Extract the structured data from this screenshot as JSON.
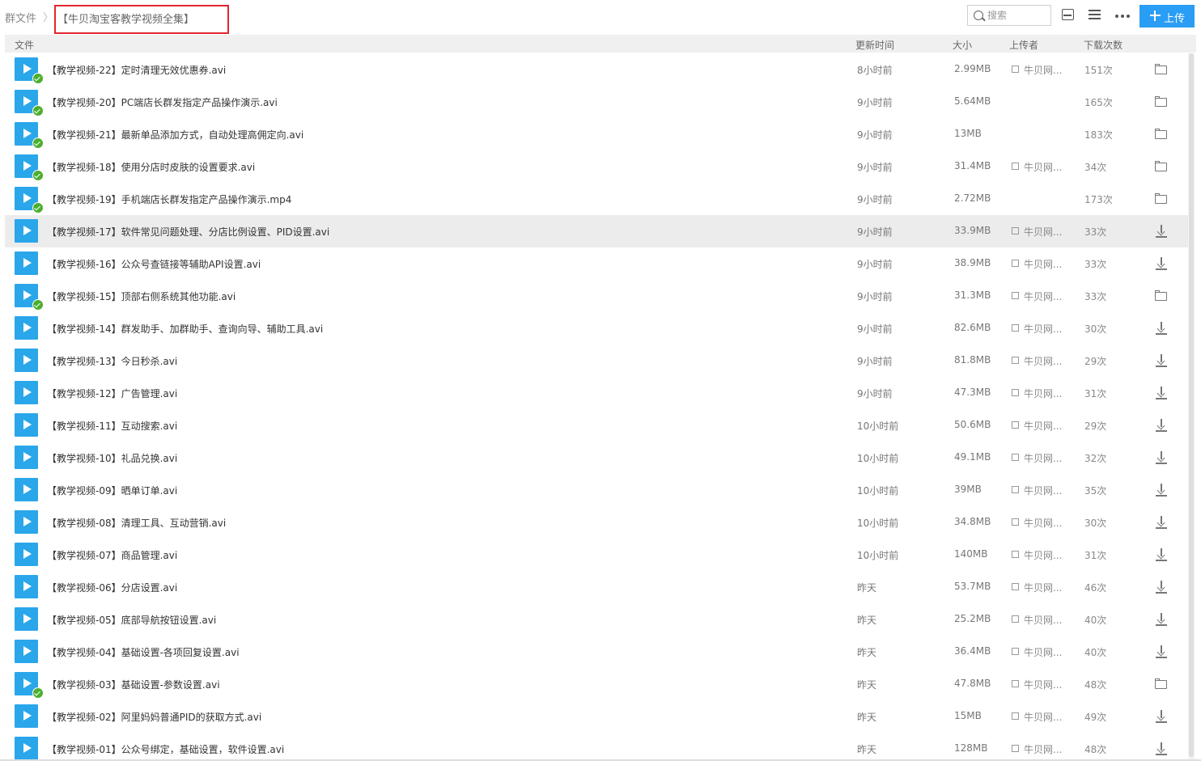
{
  "breadcrumb": {
    "root": "群文件",
    "separator": "〉",
    "current": "【牛贝淘宝客教学视频全集】"
  },
  "toolbar": {
    "search_placeholder": "搜索",
    "upload_label": "上传"
  },
  "columns": {
    "file": "文件",
    "updated": "更新时间",
    "size": "大小",
    "uploader": "上传者",
    "downloads": "下载次数"
  },
  "colors": {
    "accent": "#2a9df4",
    "play_icon": "#2aa6ea",
    "check": "#4caf2e",
    "highlight_border": "#e2262f"
  },
  "files": [
    {
      "name": "【教学视频-22】定时清理无效优惠券.avi",
      "time": "8小时前",
      "size": "2.99MB",
      "uploader": "牛贝网...",
      "downloads": "151次",
      "downloaded": true,
      "action": "folder-icon"
    },
    {
      "name": "【教学视频-20】PC端店长群发指定产品操作演示.avi",
      "time": "9小时前",
      "size": "5.64MB",
      "uploader": "",
      "downloads": "165次",
      "downloaded": true,
      "action": "folder-icon"
    },
    {
      "name": "【教学视频-21】最新单品添加方式，自动处理高佣定向.avi",
      "time": "9小时前",
      "size": "13MB",
      "uploader": "",
      "downloads": "183次",
      "downloaded": true,
      "action": "folder-icon"
    },
    {
      "name": "【教学视频-18】使用分店时皮肤的设置要求.avi",
      "time": "9小时前",
      "size": "31.4MB",
      "uploader": "牛贝网...",
      "downloads": "34次",
      "downloaded": true,
      "action": "folder-icon"
    },
    {
      "name": "【教学视频-19】手机端店长群发指定产品操作演示.mp4",
      "time": "9小时前",
      "size": "2.72MB",
      "uploader": "",
      "downloads": "173次",
      "downloaded": true,
      "action": "folder-icon"
    },
    {
      "name": "【教学视频-17】软件常见问题处理、分店比例设置、PID设置.avi",
      "time": "9小时前",
      "size": "33.9MB",
      "uploader": "牛贝网...",
      "downloads": "33次",
      "downloaded": false,
      "action": "download-icon",
      "hover": true
    },
    {
      "name": "【教学视频-16】公众号查链接等辅助API设置.avi",
      "time": "9小时前",
      "size": "38.9MB",
      "uploader": "牛贝网...",
      "downloads": "33次",
      "downloaded": false,
      "action": "download-icon"
    },
    {
      "name": "【教学视频-15】顶部右侧系统其他功能.avi",
      "time": "9小时前",
      "size": "31.3MB",
      "uploader": "牛贝网...",
      "downloads": "33次",
      "downloaded": true,
      "action": "folder-icon"
    },
    {
      "name": "【教学视频-14】群发助手、加群助手、查询向导、辅助工具.avi",
      "time": "9小时前",
      "size": "82.6MB",
      "uploader": "牛贝网...",
      "downloads": "30次",
      "downloaded": false,
      "action": "download-icon"
    },
    {
      "name": "【教学视频-13】今日秒杀.avi",
      "time": "9小时前",
      "size": "81.8MB",
      "uploader": "牛贝网...",
      "downloads": "29次",
      "downloaded": false,
      "action": "download-icon"
    },
    {
      "name": "【教学视频-12】广告管理.avi",
      "time": "9小时前",
      "size": "47.3MB",
      "uploader": "牛贝网...",
      "downloads": "31次",
      "downloaded": false,
      "action": "download-icon"
    },
    {
      "name": "【教学视频-11】互动搜索.avi",
      "time": "10小时前",
      "size": "50.6MB",
      "uploader": "牛贝网...",
      "downloads": "29次",
      "downloaded": false,
      "action": "download-icon"
    },
    {
      "name": "【教学视频-10】礼品兑换.avi",
      "time": "10小时前",
      "size": "49.1MB",
      "uploader": "牛贝网...",
      "downloads": "32次",
      "downloaded": false,
      "action": "download-icon"
    },
    {
      "name": "【教学视频-09】晒单订单.avi",
      "time": "10小时前",
      "size": "39MB",
      "uploader": "牛贝网...",
      "downloads": "35次",
      "downloaded": false,
      "action": "download-icon"
    },
    {
      "name": "【教学视频-08】清理工具、互动营销.avi",
      "time": "10小时前",
      "size": "34.8MB",
      "uploader": "牛贝网...",
      "downloads": "30次",
      "downloaded": false,
      "action": "download-icon"
    },
    {
      "name": "【教学视频-07】商品管理.avi",
      "time": "10小时前",
      "size": "140MB",
      "uploader": "牛贝网...",
      "downloads": "31次",
      "downloaded": false,
      "action": "download-icon"
    },
    {
      "name": "【教学视频-06】分店设置.avi",
      "time": "昨天",
      "size": "53.7MB",
      "uploader": "牛贝网...",
      "downloads": "46次",
      "downloaded": false,
      "action": "download-icon"
    },
    {
      "name": "【教学视频-05】底部导航按钮设置.avi",
      "time": "昨天",
      "size": "25.2MB",
      "uploader": "牛贝网...",
      "downloads": "40次",
      "downloaded": false,
      "action": "download-icon"
    },
    {
      "name": "【教学视频-04】基础设置-各项回复设置.avi",
      "time": "昨天",
      "size": "36.4MB",
      "uploader": "牛贝网...",
      "downloads": "40次",
      "downloaded": false,
      "action": "download-icon"
    },
    {
      "name": "【教学视频-03】基础设置-参数设置.avi",
      "time": "昨天",
      "size": "47.8MB",
      "uploader": "牛贝网...",
      "downloads": "48次",
      "downloaded": true,
      "action": "folder-icon"
    },
    {
      "name": "【教学视频-02】阿里妈妈普通PID的获取方式.avi",
      "time": "昨天",
      "size": "15MB",
      "uploader": "牛贝网...",
      "downloads": "49次",
      "downloaded": false,
      "action": "download-icon"
    },
    {
      "name": "【教学视频-01】公众号绑定，基础设置，软件设置.avi",
      "time": "昨天",
      "size": "128MB",
      "uploader": "牛贝网...",
      "downloads": "48次",
      "downloaded": false,
      "action": "download-icon"
    }
  ]
}
